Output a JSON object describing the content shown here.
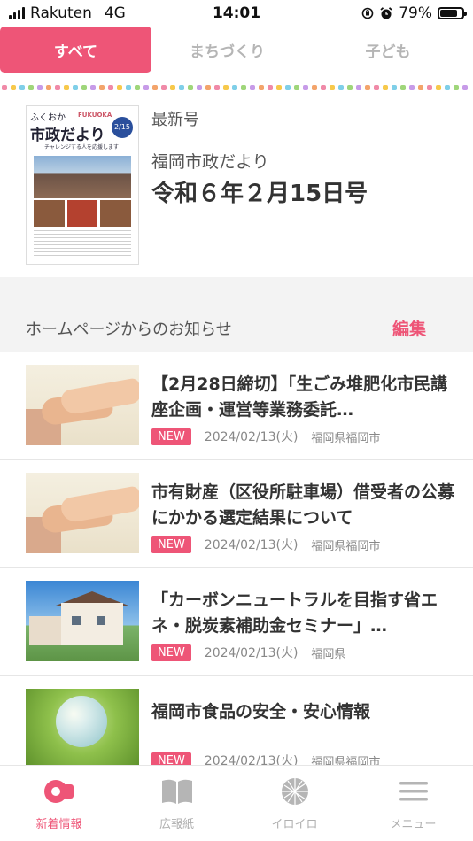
{
  "status_bar": {
    "carrier": "Rakuten",
    "network": "4G",
    "time": "14:01",
    "battery": "79%",
    "battery_level": 0.79
  },
  "tabs": [
    {
      "label": "すべて",
      "active": true
    },
    {
      "label": "まちづくり",
      "active": false
    },
    {
      "label": "子ども",
      "active": false
    }
  ],
  "latest": {
    "label": "最新号",
    "publication": "福岡市政だより",
    "issue": "令和６年２月15日号",
    "cover": {
      "title_top": "ふくおか",
      "title_main": "市政だより",
      "title_en": "FUKUOKA",
      "date_badge": "2/15",
      "tagline": "チャレンジする人を応援します"
    }
  },
  "section": {
    "title": "ホームページからのお知らせ",
    "edit_label": "編集"
  },
  "news": [
    {
      "title": "【2月28日締切】「生ごみ堆肥化市民講座企画・運営等業務委託…",
      "badge": "NEW",
      "date": "2024/02/13(火)",
      "source": "福岡県福岡市",
      "thumb": "hands"
    },
    {
      "title": "市有財産（区役所駐車場）借受者の公募にかかる選定結果について",
      "badge": "NEW",
      "date": "2024/02/13(火)",
      "source": "福岡県福岡市",
      "thumb": "hands"
    },
    {
      "title": "「カーボンニュートラルを目指す省エネ・脱炭素補助金セミナー」…",
      "badge": "NEW",
      "date": "2024/02/13(火)",
      "source": "福岡県",
      "thumb": "house"
    },
    {
      "title": "福岡市食品の安全・安心情報",
      "badge": "NEW",
      "date": "2024/02/13(火)",
      "source": "福岡県福岡市",
      "thumb": "globe"
    }
  ],
  "bottom_nav": [
    {
      "label": "新着情報",
      "icon": "megaphone-icon",
      "active": true
    },
    {
      "label": "広報紙",
      "icon": "book-icon",
      "active": false
    },
    {
      "label": "イロイロ",
      "icon": "globe-grid-icon",
      "active": false
    },
    {
      "label": "メニュー",
      "icon": "menu-icon",
      "active": false
    }
  ],
  "colors": {
    "accent": "#ee5577",
    "muted": "#b0b0b0",
    "section_bg": "#f3f3f3"
  }
}
